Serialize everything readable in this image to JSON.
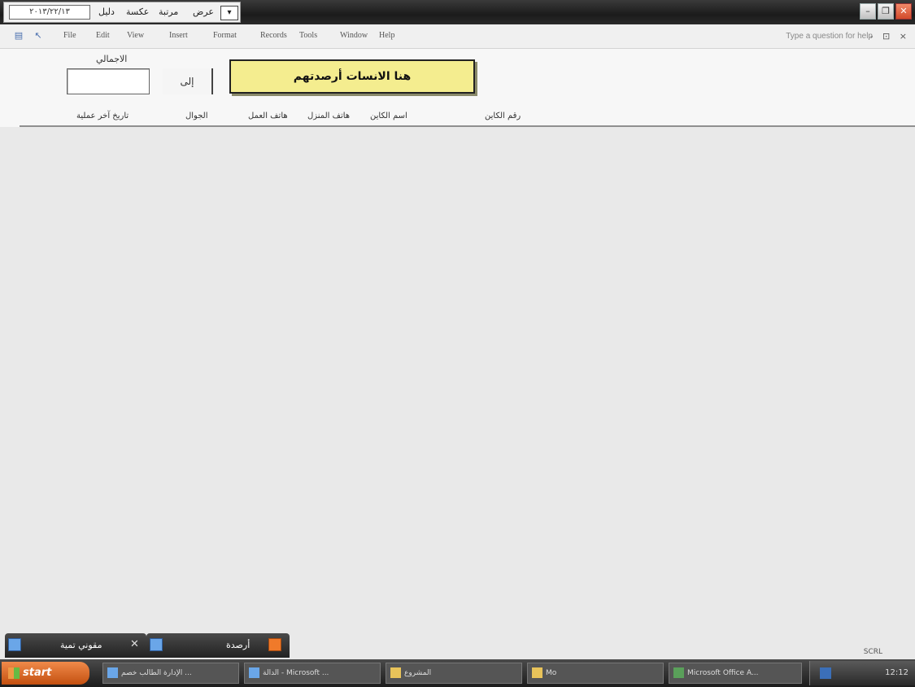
{
  "titlebar": {
    "field_value": "٢٠١٣/٢٢/١٣",
    "tabs": [
      "دليل",
      "عكسة",
      "مرتبة",
      "عرض"
    ],
    "dropdown_glyph": "▾"
  },
  "menubar": {
    "items": [
      "File",
      "Edit",
      "View",
      "Insert",
      "Format",
      "Records",
      "Tools",
      "Window",
      "Help"
    ],
    "help_placeholder": "Type a question for help",
    "help_controls": "- ⊡ ×"
  },
  "form": {
    "total_label": "الاجمالي",
    "small_button_label": "إلى",
    "title": "هنا الانسات أرصدتهم",
    "columns": [
      "رقم الكاين",
      "اسم الكاين",
      "هاتف المنزل",
      "هاتف العمل",
      "الجوال",
      "تاريخ آخر عملية"
    ]
  },
  "sheet_tabs": [
    {
      "label": "مقوني تمية"
    },
    {
      "label": "أرصدة"
    }
  ],
  "status": {
    "scrl": "SCRL"
  },
  "taskbar": {
    "start_label": "start",
    "tasks": [
      {
        "label": "الإدارة الطالب خصم ..."
      },
      {
        "label": "الدالة - Microsoft ..."
      },
      {
        "label": "المشروع"
      },
      {
        "label": "Mo"
      },
      {
        "label": "Microsoft Office A..."
      }
    ],
    "clock": "12:12"
  }
}
